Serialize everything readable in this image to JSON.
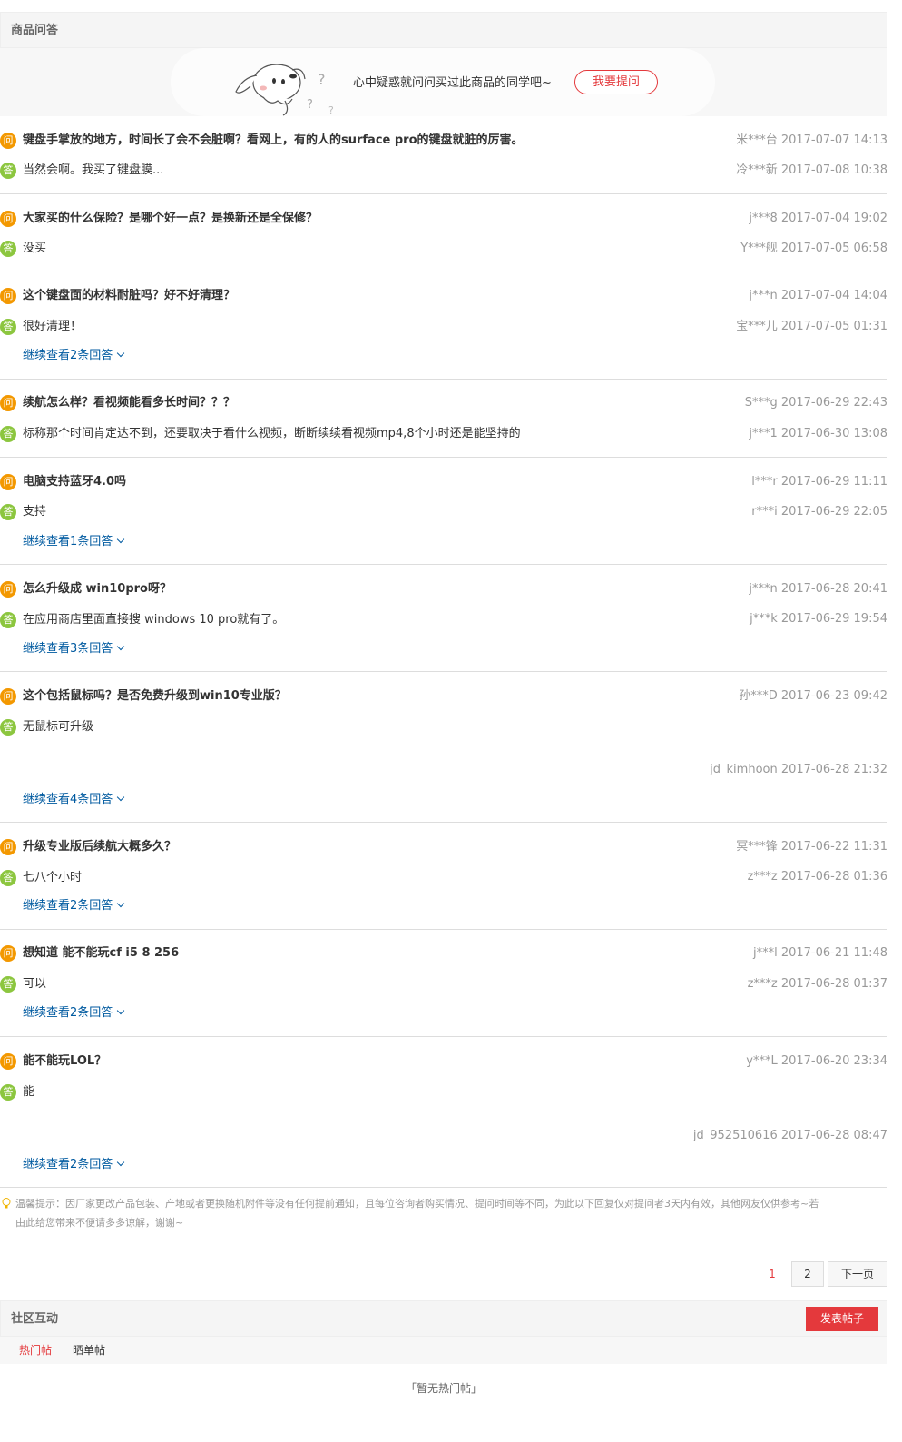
{
  "qa_section": {
    "title": "商品问答",
    "ask_prompt": "心中疑惑就问问买过此商品的同学吧~",
    "ask_button": "我要提问",
    "q_badge": "问",
    "a_badge": "答",
    "items": [
      {
        "question": "键盘手掌放的地方，时间长了会不会脏啊？看网上，有的人的surface pro的键盘就脏的厉害。",
        "q_meta": "米***台 2017-07-07 14:13",
        "answer": "当然会啊。我买了键盘膜...",
        "a_meta": "冷***新 2017-07-08 10:38",
        "more": ""
      },
      {
        "question": "大家买的什么保险？是哪个好一点？是换新还是全保修？",
        "q_meta": "j***8 2017-07-04 19:02",
        "answer": "没买",
        "a_meta": "Y***舰 2017-07-05 06:58",
        "more": ""
      },
      {
        "question": "这个键盘面的材料耐脏吗？好不好清理？",
        "q_meta": "j***n 2017-07-04 14:04",
        "answer": "很好清理！",
        "a_meta": "宝***儿 2017-07-05 01:31",
        "more": "继续查看2条回答"
      },
      {
        "question": "续航怎么样？看视频能看多长时间？？？",
        "q_meta": "S***g 2017-06-29 22:43",
        "answer": "标称那个时间肯定达不到，还要取决于看什么视频，断断续续看视频mp4,8个小时还是能坚持的",
        "a_meta": "j***1 2017-06-30 13:08",
        "more": ""
      },
      {
        "question": "电脑支持蓝牙4.0吗",
        "q_meta": "l***r 2017-06-29 11:11",
        "answer": "支持",
        "a_meta": "r***i 2017-06-29 22:05",
        "more": "继续查看1条回答"
      },
      {
        "question": "怎么升级成 win10pro呀？",
        "q_meta": "j***n 2017-06-28 20:41",
        "answer": "在应用商店里面直接搜 windows 10 pro就有了。",
        "a_meta": "j***k 2017-06-29 19:54",
        "more": "继续查看3条回答"
      },
      {
        "question": "这个包括鼠标吗？是否免费升级到win10专业版？",
        "q_meta": "孙***D 2017-06-23 09:42",
        "answer": "无鼠标可升级",
        "a_meta": "jd_kimhoon 2017-06-28 21:32",
        "more": "继续查看4条回答"
      },
      {
        "question": "升级专业版后续航大概多久？",
        "q_meta": "冥***锋 2017-06-22 11:31",
        "answer": "七八个小时",
        "a_meta": "z***z 2017-06-28 01:36",
        "more": "继续查看2条回答"
      },
      {
        "question": "想知道 能不能玩cf i5 8 256",
        "q_meta": "j***l 2017-06-21 11:48",
        "answer": "可以",
        "a_meta": "z***z 2017-06-28 01:37",
        "more": "继续查看2条回答"
      },
      {
        "question": "能不能玩LOL？",
        "q_meta": "y***L 2017-06-20 23:34",
        "answer": "能",
        "a_meta": "jd_952510616 2017-06-28 08:47",
        "more": "继续查看2条回答"
      }
    ],
    "tip_line1": "温馨提示：因厂家更改产品包装、产地或者更换随机附件等没有任何提前通知，且每位咨询者购买情况、提问时间等不同，为此以下回复仅对提问者3天内有效，其他网友仅供参考~若",
    "tip_line2": "由此给您带来不便请多多谅解，谢谢~"
  },
  "pager": {
    "current": "1",
    "page2": "2",
    "next": "下一页"
  },
  "community": {
    "title": "社区互动",
    "post_button": "发表帖子",
    "tabs": [
      "热门帖",
      "晒单帖"
    ],
    "empty": "「暂无热门帖」"
  },
  "colors": {
    "accent": "#e4393c",
    "q_badge": "#f39800",
    "a_badge": "#8cc63f",
    "link": "#005aa0"
  }
}
